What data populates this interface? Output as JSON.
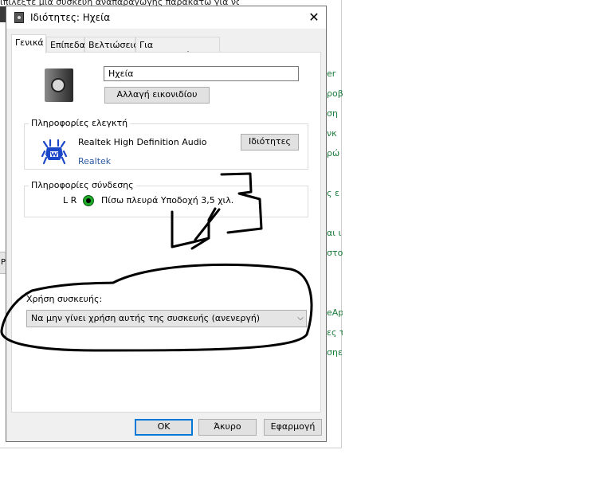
{
  "background_window": {
    "top_text": "ιπιλέξτε μια συσκευή αναπαραγωγής παρακάτω για να",
    "left_tab_fragment": "P",
    "link_fragments": [
      "er",
      "ροβ",
      "ση",
      "νκ",
      "ρώ",
      "ς ε",
      "αι ι",
      "στο",
      "eAp",
      "ες τ",
      "σηε"
    ]
  },
  "dialog": {
    "title": "Ιδιότητες: Ηχεία",
    "icon": "speaker-small-icon",
    "close_glyph": "✕"
  },
  "tabs": [
    {
      "label": "Γενικά",
      "active": true
    },
    {
      "label": "Επίπεδα",
      "active": false
    },
    {
      "label": "Βελτιώσεις",
      "active": false
    },
    {
      "label": "Για προχωρημένους",
      "active": false
    }
  ],
  "general": {
    "device_icon": "speaker-icon",
    "device_name": "Ηχεία",
    "change_icon_label": "Αλλαγή εικονιδίου",
    "controller": {
      "group_label": "Πληροφορίες ελεγκτή",
      "logo_icon": "realtek-crab-icon",
      "name": "Realtek High Definition Audio",
      "vendor": "Realtek",
      "properties_label": "Ιδιότητες"
    },
    "connection": {
      "group_label": "Πληροφορίες σύνδεσης",
      "channels": "L R",
      "jack_icon": "green-jack-icon",
      "jack_color": "#1faa2a",
      "jack_label": "Πίσω πλευρά Υποδοχή 3,5 χιλ."
    },
    "usage": {
      "label": "Χρήση συσκευής:",
      "selected": "Να μην γίνει χρήση αυτής της συσκευής (ανενεργή)",
      "arrow_glyph": "⌵"
    }
  },
  "footer": {
    "ok": "OK",
    "cancel": "Άκυρο",
    "apply": "Εφαρμογή"
  },
  "colors": {
    "accent_focus": "#0078d7",
    "link_vendor": "#2c5aa0",
    "background_links": "#1b7a3a"
  }
}
